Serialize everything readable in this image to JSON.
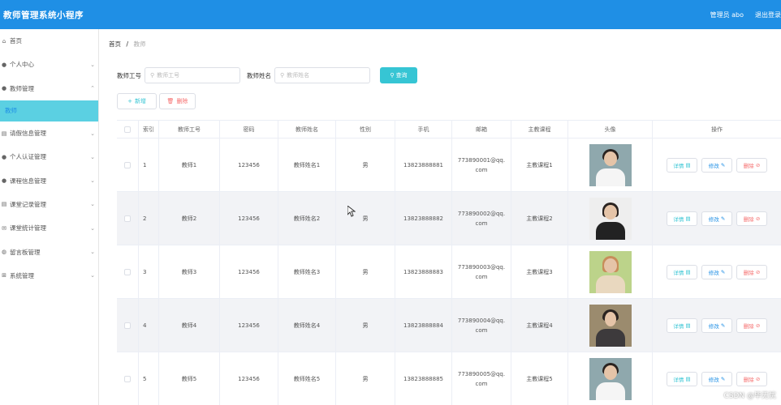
{
  "header": {
    "title": "教师管理系统小程序",
    "user": "管理员 abo",
    "logout": "退出登录"
  },
  "sidebar": {
    "items": [
      {
        "label": "首页",
        "icon": "home-icon",
        "arrow": false
      },
      {
        "label": "个人中心",
        "icon": "user-icon",
        "arrow": true
      },
      {
        "label": "教师管理",
        "icon": "user-icon",
        "arrow": true,
        "expanded": true
      },
      {
        "label": "教师",
        "sub": true
      },
      {
        "label": "请假信息管理",
        "icon": "doc-icon",
        "arrow": true
      },
      {
        "label": "个人认证管理",
        "icon": "user-icon",
        "arrow": true
      },
      {
        "label": "课程信息管理",
        "icon": "user-icon",
        "arrow": true
      },
      {
        "label": "课堂记录管理",
        "icon": "doc-icon",
        "arrow": true
      },
      {
        "label": "课堂统计管理",
        "icon": "mail-icon",
        "arrow": true
      },
      {
        "label": "留言板管理",
        "icon": "pin-icon",
        "arrow": true
      },
      {
        "label": "系统管理",
        "icon": "grid-icon",
        "arrow": true
      }
    ]
  },
  "breadcrumb": {
    "home": "首页",
    "sep": "/",
    "current": "教师"
  },
  "search": {
    "field1_label": "教师工号",
    "field1_placeholder": "教师工号",
    "field2_label": "教师姓名",
    "field2_placeholder": "教师姓名",
    "button": "查询"
  },
  "actions": {
    "add": "新增",
    "delete": "删除"
  },
  "table": {
    "headers": [
      "索引",
      "教师工号",
      "密码",
      "教师姓名",
      "性别",
      "手机",
      "邮箱",
      "主教课程",
      "头像",
      "操作"
    ],
    "rows": [
      {
        "index": "1",
        "id": "教师1",
        "password": "123456",
        "name": "教师姓名1",
        "gender": "男",
        "phone": "13823888881",
        "email": "773890001@qq.com",
        "course": "主教课程1"
      },
      {
        "index": "2",
        "id": "教师2",
        "password": "123456",
        "name": "教师姓名2",
        "gender": "男",
        "phone": "13823888882",
        "email": "773890002@qq.com",
        "course": "主教课程2"
      },
      {
        "index": "3",
        "id": "教师3",
        "password": "123456",
        "name": "教师姓名3",
        "gender": "男",
        "phone": "13823888883",
        "email": "773890003@qq.com",
        "course": "主教课程3"
      },
      {
        "index": "4",
        "id": "教师4",
        "password": "123456",
        "name": "教师姓名4",
        "gender": "男",
        "phone": "13823888884",
        "email": "773890004@qq.com",
        "course": "主教课程4"
      },
      {
        "index": "5",
        "id": "教师5",
        "password": "123456",
        "name": "教师姓名5",
        "gender": "男",
        "phone": "13823888885",
        "email": "773890005@qq.com",
        "course": "主教课程5"
      }
    ],
    "ops": {
      "detail": "详情",
      "edit": "修改",
      "delete": "删除"
    }
  },
  "watermark": "CSDN @毕无忧",
  "colors": {
    "header": "#1f8fe5",
    "accent": "#36c5d4",
    "danger": "#f56c6c",
    "active_menu": "#5bd0e2"
  }
}
